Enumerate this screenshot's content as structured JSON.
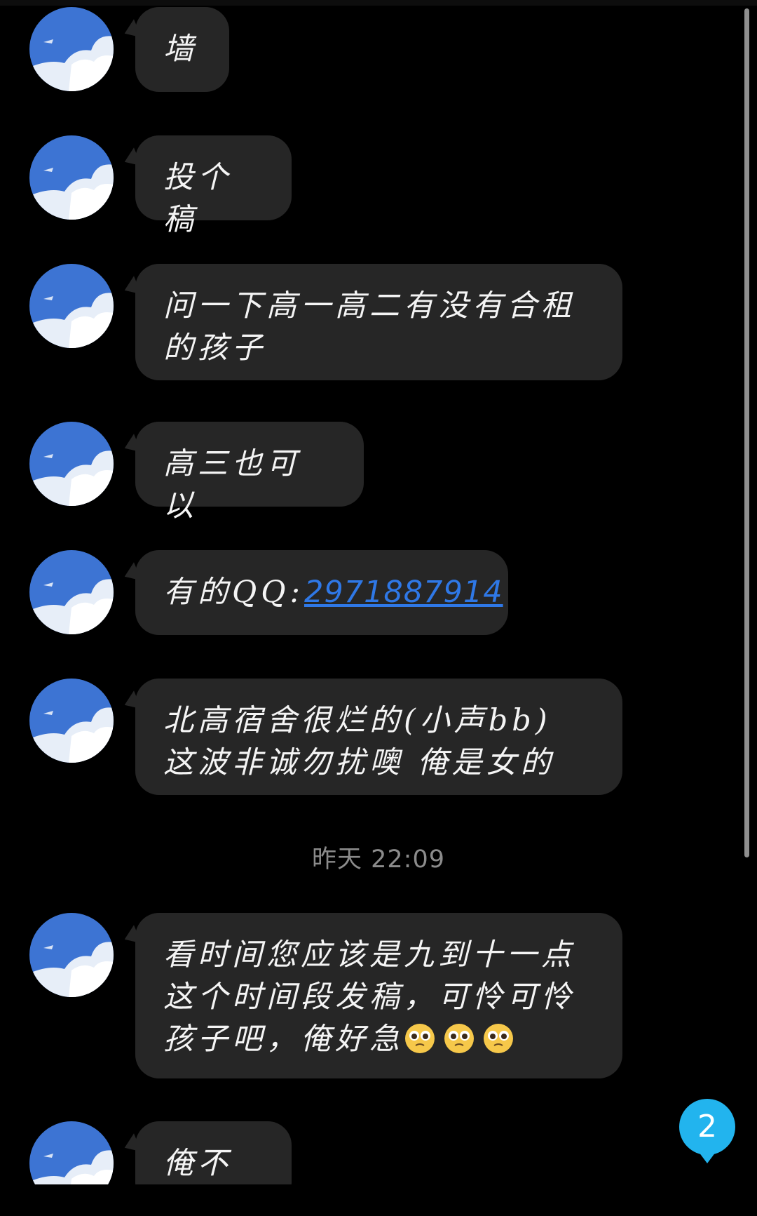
{
  "messages": [
    {
      "text": "墙"
    },
    {
      "text": "投个稿"
    },
    {
      "text": "问一下高一高二有没有合租的孩子"
    },
    {
      "text": "高三也可以"
    },
    {
      "prefix": "有的QQ:",
      "link": "2971887914"
    },
    {
      "text": "北高宿舍很烂的(小声bb) 这波非诚勿扰噢 俺是女的"
    },
    {
      "text": "看时间您应该是九到十一点这个时间段发稿，可怜可怜孩子吧，俺好急",
      "emoji_count": 3,
      "emoji_icon": "pleading-face-emoji"
    },
    {
      "text": "俺不匿"
    }
  ],
  "timestamp": "昨天 22:09",
  "unread_badge": "2",
  "colors": {
    "background": "#000000",
    "bubble": "#262626",
    "link": "#2f78e6",
    "badge": "#22b4ee",
    "timestamp": "#8b8b8b"
  },
  "avatar_icon": "sky-cloud-avatar"
}
